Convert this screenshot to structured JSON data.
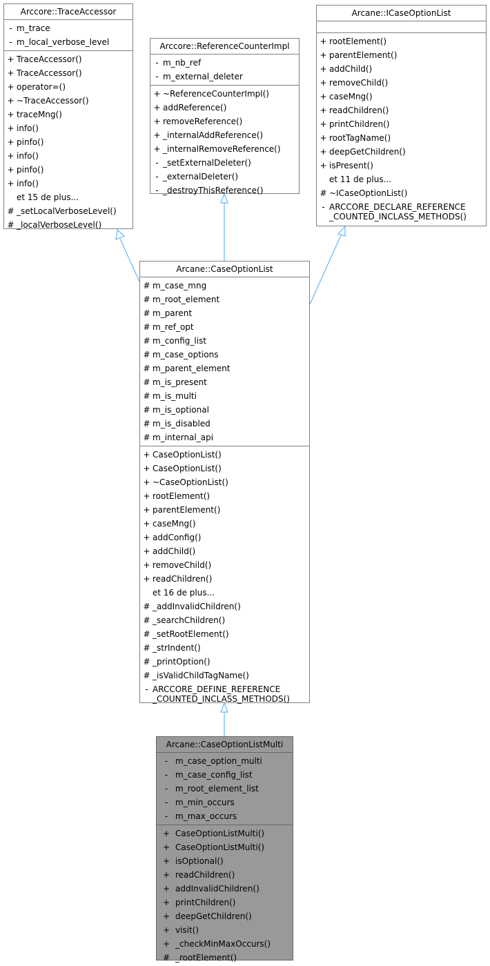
{
  "classes": {
    "trace_accessor": {
      "title": "Arccore::TraceAccessor",
      "attributes": [
        {
          "vis": "-",
          "name": "m_trace"
        },
        {
          "vis": "-",
          "name": "m_local_verbose_level"
        }
      ],
      "methods": [
        {
          "vis": "+",
          "name": "TraceAccessor()"
        },
        {
          "vis": "+",
          "name": "TraceAccessor()"
        },
        {
          "vis": "+",
          "name": "operator=()"
        },
        {
          "vis": "+",
          "name": "~TraceAccessor()"
        },
        {
          "vis": "+",
          "name": "traceMng()"
        },
        {
          "vis": "+",
          "name": "info()"
        },
        {
          "vis": "+",
          "name": "pinfo()"
        },
        {
          "vis": "+",
          "name": "info()"
        },
        {
          "vis": "+",
          "name": "pinfo()"
        },
        {
          "vis": "+",
          "name": "info()"
        },
        {
          "vis": "",
          "name": "et 15 de plus..."
        },
        {
          "vis": "#",
          "name": "_setLocalVerboseLevel()"
        },
        {
          "vis": "#",
          "name": "_localVerboseLevel()"
        }
      ]
    },
    "reference_counter_impl": {
      "title": "Arccore::ReferenceCounterImpl",
      "attributes": [
        {
          "vis": "-",
          "name": "m_nb_ref"
        },
        {
          "vis": "-",
          "name": "m_external_deleter"
        }
      ],
      "methods": [
        {
          "vis": "+",
          "name": "~ReferenceCounterImpl()"
        },
        {
          "vis": "+",
          "name": "addReference()"
        },
        {
          "vis": "+",
          "name": "removeReference()"
        },
        {
          "vis": "+",
          "name": "_internalAddReference()"
        },
        {
          "vis": "+",
          "name": "_internalRemoveReference()"
        },
        {
          "vis": "-",
          "name": "_setExternalDeleter()"
        },
        {
          "vis": "-",
          "name": "_externalDeleter()"
        },
        {
          "vis": "-",
          "name": "_destroyThisReference()"
        }
      ]
    },
    "icase_option_list": {
      "title": "Arcane::ICaseOptionList",
      "attributes": [],
      "methods": [
        {
          "vis": "+",
          "name": "rootElement()"
        },
        {
          "vis": "+",
          "name": "parentElement()"
        },
        {
          "vis": "+",
          "name": "addChild()"
        },
        {
          "vis": "+",
          "name": "removeChild()"
        },
        {
          "vis": "+",
          "name": "caseMng()"
        },
        {
          "vis": "+",
          "name": "readChildren()"
        },
        {
          "vis": "+",
          "name": "printChildren()"
        },
        {
          "vis": "+",
          "name": "rootTagName()"
        },
        {
          "vis": "+",
          "name": "deepGetChildren()"
        },
        {
          "vis": "+",
          "name": "isPresent()"
        },
        {
          "vis": "",
          "name": "et 11 de plus..."
        },
        {
          "vis": "#",
          "name": "~ICaseOptionList()"
        },
        {
          "vis": "-",
          "name": "ARCCORE_DECLARE_REFERENCE\n_COUNTED_INCLASS_METHODS()"
        }
      ]
    },
    "case_option_list": {
      "title": "Arcane::CaseOptionList",
      "attributes": [
        {
          "vis": "#",
          "name": "m_case_mng"
        },
        {
          "vis": "#",
          "name": "m_root_element"
        },
        {
          "vis": "#",
          "name": "m_parent"
        },
        {
          "vis": "#",
          "name": "m_ref_opt"
        },
        {
          "vis": "#",
          "name": "m_config_list"
        },
        {
          "vis": "#",
          "name": "m_case_options"
        },
        {
          "vis": "#",
          "name": "m_parent_element"
        },
        {
          "vis": "#",
          "name": "m_is_present"
        },
        {
          "vis": "#",
          "name": "m_is_multi"
        },
        {
          "vis": "#",
          "name": "m_is_optional"
        },
        {
          "vis": "#",
          "name": "m_is_disabled"
        },
        {
          "vis": "#",
          "name": "m_internal_api"
        }
      ],
      "methods": [
        {
          "vis": "+",
          "name": "CaseOptionList()"
        },
        {
          "vis": "+",
          "name": "CaseOptionList()"
        },
        {
          "vis": "+",
          "name": "~CaseOptionList()"
        },
        {
          "vis": "+",
          "name": "rootElement()"
        },
        {
          "vis": "+",
          "name": "parentElement()"
        },
        {
          "vis": "+",
          "name": "caseMng()"
        },
        {
          "vis": "+",
          "name": "addConfig()"
        },
        {
          "vis": "+",
          "name": "addChild()"
        },
        {
          "vis": "+",
          "name": "removeChild()"
        },
        {
          "vis": "+",
          "name": "readChildren()"
        },
        {
          "vis": "",
          "name": "et 16 de plus..."
        },
        {
          "vis": "#",
          "name": "_addInvalidChildren()"
        },
        {
          "vis": "#",
          "name": "_searchChildren()"
        },
        {
          "vis": "#",
          "name": "_setRootElement()"
        },
        {
          "vis": "#",
          "name": "_strIndent()"
        },
        {
          "vis": "#",
          "name": "_printOption()"
        },
        {
          "vis": "#",
          "name": "_isValidChildTagName()"
        },
        {
          "vis": "-",
          "name": "ARCCORE_DEFINE_REFERENCE\n_COUNTED_INCLASS_METHODS()"
        }
      ]
    },
    "case_option_list_multi": {
      "title": "Arcane::CaseOptionListMulti",
      "attributes": [
        {
          "vis": "-",
          "name": "m_case_option_multi"
        },
        {
          "vis": "-",
          "name": "m_case_config_list"
        },
        {
          "vis": "-",
          "name": "m_root_element_list"
        },
        {
          "vis": "-",
          "name": "m_min_occurs"
        },
        {
          "vis": "-",
          "name": "m_max_occurs"
        }
      ],
      "methods": [
        {
          "vis": "+",
          "name": "CaseOptionListMulti()"
        },
        {
          "vis": "+",
          "name": "CaseOptionListMulti()"
        },
        {
          "vis": "+",
          "name": "isOptional()"
        },
        {
          "vis": "+",
          "name": "readChildren()"
        },
        {
          "vis": "+",
          "name": "addInvalidChildren()"
        },
        {
          "vis": "+",
          "name": "printChildren()"
        },
        {
          "vis": "+",
          "name": "deepGetChildren()"
        },
        {
          "vis": "+",
          "name": "visit()"
        },
        {
          "vis": "+",
          "name": "_checkMinMaxOccurs()"
        },
        {
          "vis": "#",
          "name": "_rootElement()"
        }
      ]
    }
  },
  "edges": [
    {
      "from": "case_option_list",
      "to": "trace_accessor",
      "type": "inheritance"
    },
    {
      "from": "case_option_list",
      "to": "reference_counter_impl",
      "type": "inheritance"
    },
    {
      "from": "case_option_list",
      "to": "icase_option_list",
      "type": "inheritance"
    },
    {
      "from": "case_option_list_multi",
      "to": "case_option_list",
      "type": "inheritance"
    }
  ],
  "colors": {
    "edge": "#63b8ff",
    "border": "#808080",
    "highlight_fill": "#999999"
  }
}
